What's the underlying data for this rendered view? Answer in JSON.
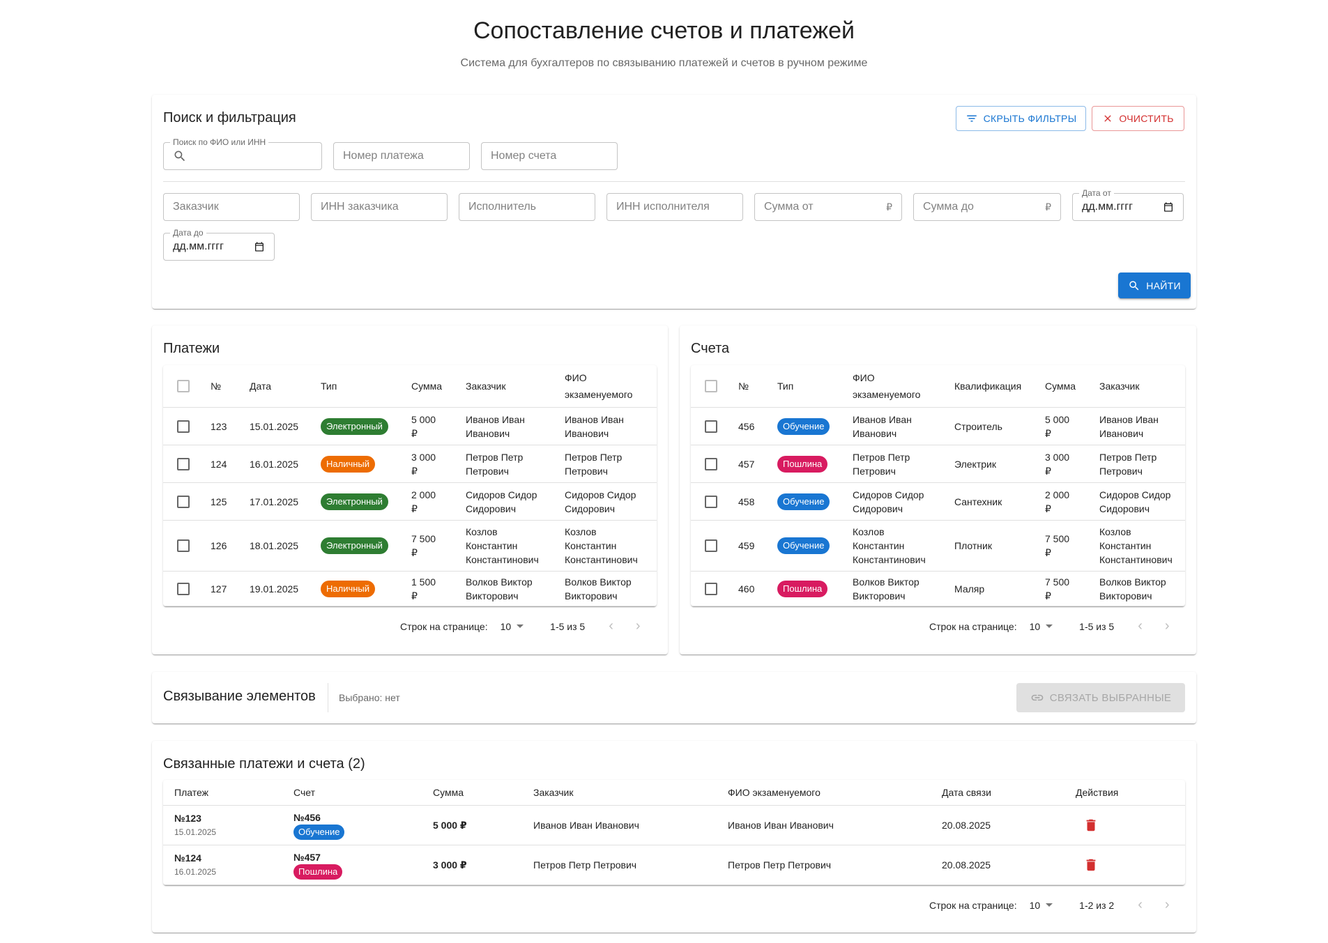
{
  "header": {
    "title": "Сопоставление счетов и платежей",
    "subtitle": "Система для бухгалтеров по связыванию платежей и счетов в ручном режиме"
  },
  "filters": {
    "title": "Поиск и фильтрация",
    "hide_btn": "Скрыть фильтры",
    "clear_btn": "Очистить",
    "search_label": "Поиск по ФИО или ИНН",
    "payment_number": "Номер платежа",
    "invoice_number": "Номер счета",
    "customer": "Заказчик",
    "customer_inn": "ИНН заказчика",
    "executor": "Исполнитель",
    "executor_inn": "ИНН исполнителя",
    "sum_from": "Сумма от",
    "sum_to": "Сумма до",
    "currency": "₽",
    "date_from_label": "Дата от",
    "date_to_label": "Дата до",
    "date_placeholder": "дд.мм.гггг",
    "find_btn": "Найти"
  },
  "payments": {
    "title": "Платежи",
    "columns": [
      "№",
      "Дата",
      "Тип",
      "Сумма",
      "Заказчик",
      "ФИО экзаменуемого"
    ],
    "rows": [
      {
        "num": "123",
        "date": "15.01.2025",
        "type": "Электронный",
        "type_color": "#2e7d32",
        "sum1": "5 000",
        "sum2": "₽",
        "customer": [
          "Иванов Иван",
          "Иванович"
        ],
        "fio": [
          "Иванов Иван",
          "Иванович"
        ]
      },
      {
        "num": "124",
        "date": "16.01.2025",
        "type": "Наличный",
        "type_color": "#ed6c02",
        "sum1": "3 000",
        "sum2": "₽",
        "customer": [
          "Петров Петр",
          "Петрович"
        ],
        "fio": [
          "Петров Петр",
          "Петрович"
        ]
      },
      {
        "num": "125",
        "date": "17.01.2025",
        "type": "Электронный",
        "type_color": "#2e7d32",
        "sum1": "2 000",
        "sum2": "₽",
        "customer": [
          "Сидоров Сидор",
          "Сидорович"
        ],
        "fio": [
          "Сидоров Сидор",
          "Сидорович"
        ]
      },
      {
        "num": "126",
        "date": "18.01.2025",
        "type": "Электронный",
        "type_color": "#2e7d32",
        "sum1": "7 500",
        "sum2": "₽",
        "customer": [
          "Козлов",
          "Константин",
          "Константинович"
        ],
        "fio": [
          "Козлов",
          "Константин",
          "Константинович"
        ]
      },
      {
        "num": "127",
        "date": "19.01.2025",
        "type": "Наличный",
        "type_color": "#ed6c02",
        "sum1": "1 500",
        "sum2": "₽",
        "customer": [
          "Волков Виктор",
          "Викторович"
        ],
        "fio": [
          "Волков Виктор",
          "Викторович"
        ]
      }
    ],
    "pagination": {
      "rows_label": "Строк на странице:",
      "per_page": "10",
      "range": "1-5 из 5"
    }
  },
  "invoices": {
    "title": "Счета",
    "columns": [
      "№",
      "Тип",
      "ФИО экзаменуемого",
      "Квалификация",
      "Сумма",
      "Заказчик"
    ],
    "rows": [
      {
        "num": "456",
        "type": "Обучение",
        "type_color": "#1976d2",
        "fio": [
          "Иванов Иван",
          "Иванович"
        ],
        "qual": "Строитель",
        "sum1": "5 000",
        "sum2": "₽",
        "customer": [
          "Иванов Иван",
          "Иванович"
        ]
      },
      {
        "num": "457",
        "type": "Пошлина",
        "type_color": "#d81b60",
        "fio": [
          "Петров Петр",
          "Петрович"
        ],
        "qual": "Электрик",
        "sum1": "3 000",
        "sum2": "₽",
        "customer": [
          "Петров Петр",
          "Петрович"
        ]
      },
      {
        "num": "458",
        "type": "Обучение",
        "type_color": "#1976d2",
        "fio": [
          "Сидоров Сидор",
          "Сидорович"
        ],
        "qual": "Сантехник",
        "sum1": "2 000",
        "sum2": "₽",
        "customer": [
          "Сидоров Сидор",
          "Сидорович"
        ]
      },
      {
        "num": "459",
        "type": "Обучение",
        "type_color": "#1976d2",
        "fio": [
          "Козлов",
          "Константин",
          "Константинович"
        ],
        "qual": "Плотник",
        "sum1": "7 500",
        "sum2": "₽",
        "customer": [
          "Козлов",
          "Константин",
          "Константинович"
        ]
      },
      {
        "num": "460",
        "type": "Пошлина",
        "type_color": "#d81b60",
        "fio": [
          "Волков Виктор",
          "Викторович"
        ],
        "qual": "Маляр",
        "sum1": "7 500",
        "sum2": "₽",
        "customer": [
          "Волков Виктор",
          "Викторович"
        ]
      }
    ],
    "pagination": {
      "rows_label": "Строк на странице:",
      "per_page": "10",
      "range": "1-5 из 5"
    }
  },
  "linking": {
    "title": "Связывание элементов",
    "selected": "Выбрано: нет",
    "link_btn": "Связать выбранные"
  },
  "linked": {
    "title": "Связанные платежи и счета (2)",
    "columns": [
      "Платеж",
      "Счет",
      "Сумма",
      "Заказчик",
      "ФИО экзаменуемого",
      "Дата связи",
      "Действия"
    ],
    "rows": [
      {
        "payment": "№123",
        "payment_date": "15.01.2025",
        "invoice": "№456",
        "invoice_type": "Обучение",
        "type_color": "#1976d2",
        "sum": "5 000 ₽",
        "customer": "Иванов Иван Иванович",
        "fio": "Иванов Иван Иванович",
        "link_date": "20.08.2025"
      },
      {
        "payment": "№124",
        "payment_date": "16.01.2025",
        "invoice": "№457",
        "invoice_type": "Пошлина",
        "type_color": "#d81b60",
        "sum": "3 000 ₽",
        "customer": "Петров Петр Петрович",
        "fio": "Петров Петр Петрович",
        "link_date": "20.08.2025"
      }
    ],
    "pagination": {
      "rows_label": "Строк на странице:",
      "per_page": "10",
      "range": "1-2 из 2"
    }
  },
  "colors": {
    "primary": "#1976d2",
    "error": "#d32f2f",
    "success": "#2e7d32",
    "warning": "#ed6c02",
    "pink": "#d81b60"
  }
}
